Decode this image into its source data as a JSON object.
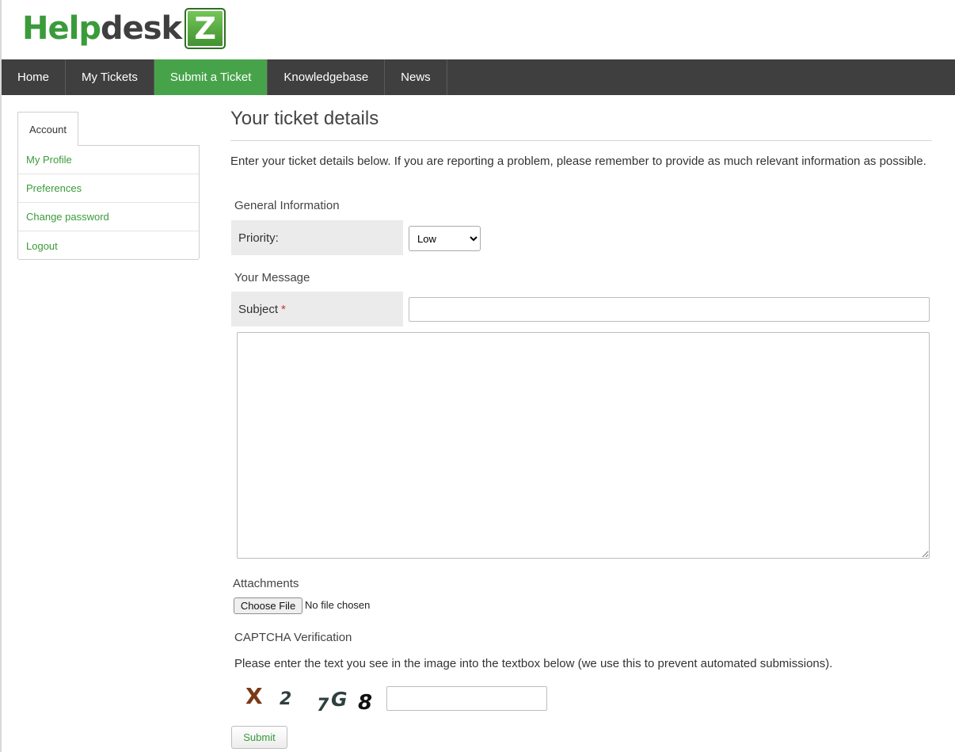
{
  "brand": {
    "logo_part1": "Help",
    "logo_part2": "desk",
    "logo_badge": "Z"
  },
  "nav": {
    "items": [
      {
        "label": "Home"
      },
      {
        "label": "My Tickets"
      },
      {
        "label": "Submit a Ticket",
        "active": true
      },
      {
        "label": "Knowledgebase"
      },
      {
        "label": "News"
      }
    ]
  },
  "sidebar": {
    "tab_label": "Account",
    "items": [
      {
        "label": "My Profile"
      },
      {
        "label": "Preferences"
      },
      {
        "label": "Change password"
      },
      {
        "label": "Logout"
      }
    ]
  },
  "main": {
    "title": "Your ticket details",
    "intro": "Enter your ticket details below. If you are reporting a problem, please remember to provide as much relevant information as possible.",
    "general_info_label": "General Information",
    "priority_label": "Priority:",
    "priority_value": "Low",
    "your_message_label": "Your Message",
    "subject_label": "Subject",
    "subject_required": "*",
    "attachments_label": "Attachments",
    "file_button": "Choose File",
    "file_status": "No file chosen",
    "captcha_label": "CAPTCHA Verification",
    "captcha_instructions": "Please enter the text you see in the image into the textbox below (we use this to prevent automated submissions).",
    "captcha_chars": [
      "X",
      "2",
      "7",
      "G",
      "8"
    ],
    "submit_label": "Submit"
  },
  "colors": {
    "accent": "#47a34a",
    "nav_bg": "#3f3f3f",
    "link": "#3a9b3a",
    "required": "#c0392b"
  }
}
